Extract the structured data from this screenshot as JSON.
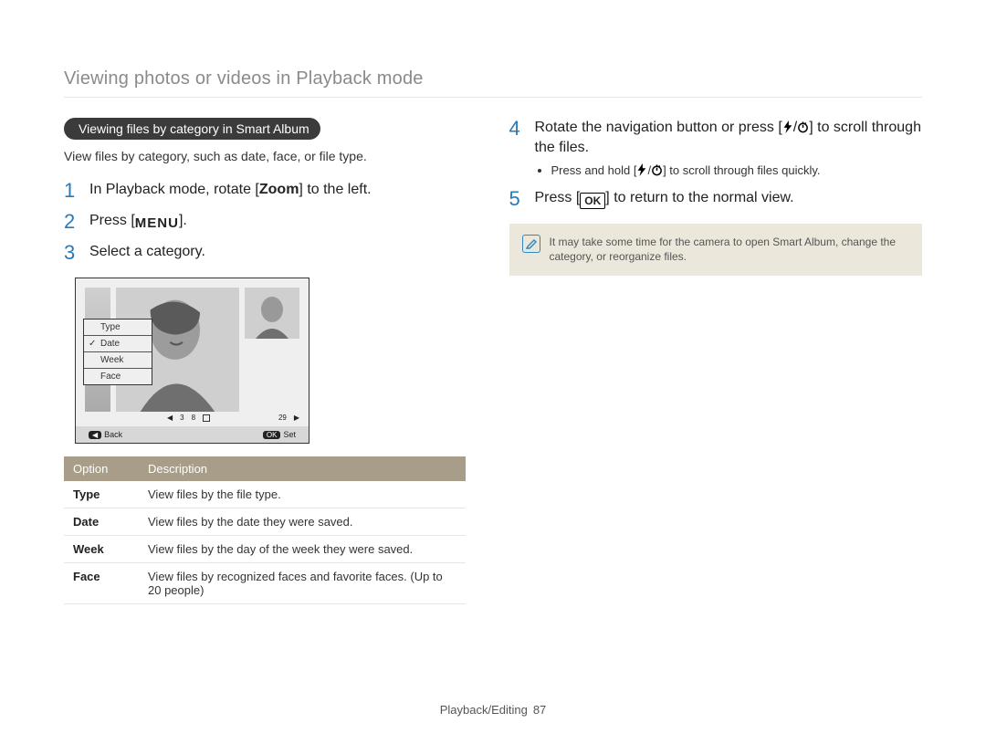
{
  "header": {
    "title": "Viewing photos or videos in Playback mode"
  },
  "left": {
    "pill": "Viewing files by category in Smart Album",
    "intro": "View files by category, such as date, face, or file type.",
    "steps": [
      {
        "num": "1",
        "text_pre": "In Playback mode, rotate [",
        "bold": "Zoom",
        "text_post": "] to the left."
      },
      {
        "num": "2",
        "text_pre": "Press [",
        "icon": "menu",
        "text_post": "]."
      },
      {
        "num": "3",
        "text_pre": "Select a category.",
        "bold": "",
        "text_post": ""
      }
    ],
    "illus": {
      "menu_items": [
        "Type",
        "Date",
        "Week",
        "Face"
      ],
      "selected_index": 1,
      "footer_back_key": "◀",
      "footer_back": "Back",
      "footer_set_key": "OK",
      "footer_set": "Set",
      "film_labels": [
        "3",
        "8",
        "29"
      ]
    },
    "table": {
      "headers": [
        "Option",
        "Description"
      ],
      "rows": [
        {
          "opt": "Type",
          "desc": "View files by the file type."
        },
        {
          "opt": "Date",
          "desc": "View files by the date they were saved."
        },
        {
          "opt": "Week",
          "desc": "View files by the day of the week they were saved."
        },
        {
          "opt": "Face",
          "desc": "View files by recognized faces and favorite faces. (Up to 20 people)"
        }
      ]
    }
  },
  "right": {
    "steps": [
      {
        "num": "4",
        "line1_pre": "Rotate the navigation button or press [",
        "line1_post": "] to scroll through the files.",
        "sub_pre": "Press and hold [",
        "sub_post": "] to scroll through files quickly."
      },
      {
        "num": "5",
        "line1_pre": "Press [",
        "line1_post": "] to return to the normal view."
      }
    ],
    "note": "It may take some time for the camera to open Smart Album, change the category, or reorganize files."
  },
  "footer": {
    "section": "Playback/Editing",
    "page": "87"
  }
}
